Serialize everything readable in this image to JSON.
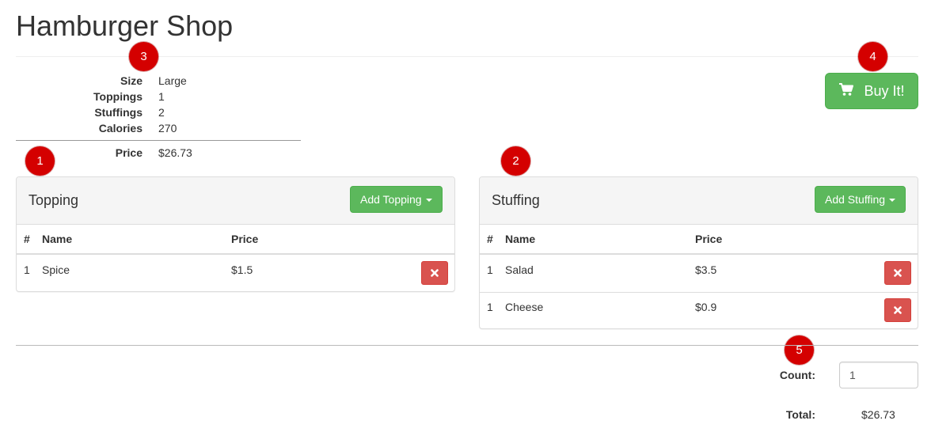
{
  "header": {
    "title": "Hamburger Shop"
  },
  "badges": {
    "topping": "1",
    "stuffing": "2",
    "summary": "3",
    "buy": "4",
    "count": "5"
  },
  "summary": {
    "rows": [
      {
        "label": "Size",
        "value": "Large"
      },
      {
        "label": "Toppings",
        "value": "1"
      },
      {
        "label": "Stuffings",
        "value": "2"
      },
      {
        "label": "Calories",
        "value": "270"
      }
    ],
    "price_label": "Price",
    "price_value": "$26.73"
  },
  "buy": {
    "label": "Buy It!",
    "icon": "shopping-cart-icon"
  },
  "topping_panel": {
    "title": "Topping",
    "add_label": "Add Topping",
    "columns": [
      "#",
      "Name",
      "Price"
    ],
    "rows": [
      {
        "num": "1",
        "name": "Spice",
        "price": "$1.5"
      }
    ]
  },
  "stuffing_panel": {
    "title": "Stuffing",
    "add_label": "Add Stuffing",
    "columns": [
      "#",
      "Name",
      "Price"
    ],
    "rows": [
      {
        "num": "1",
        "name": "Salad",
        "price": "$3.5"
      },
      {
        "num": "1",
        "name": "Cheese",
        "price": "$0.9"
      }
    ]
  },
  "order": {
    "count_label": "Count:",
    "count_value": "1",
    "total_label": "Total:",
    "total_value": "$26.73"
  },
  "colors": {
    "success": "#5cb85c",
    "danger": "#d9534f",
    "badge": "#d40000",
    "panel_heading": "#f5f5f5"
  }
}
